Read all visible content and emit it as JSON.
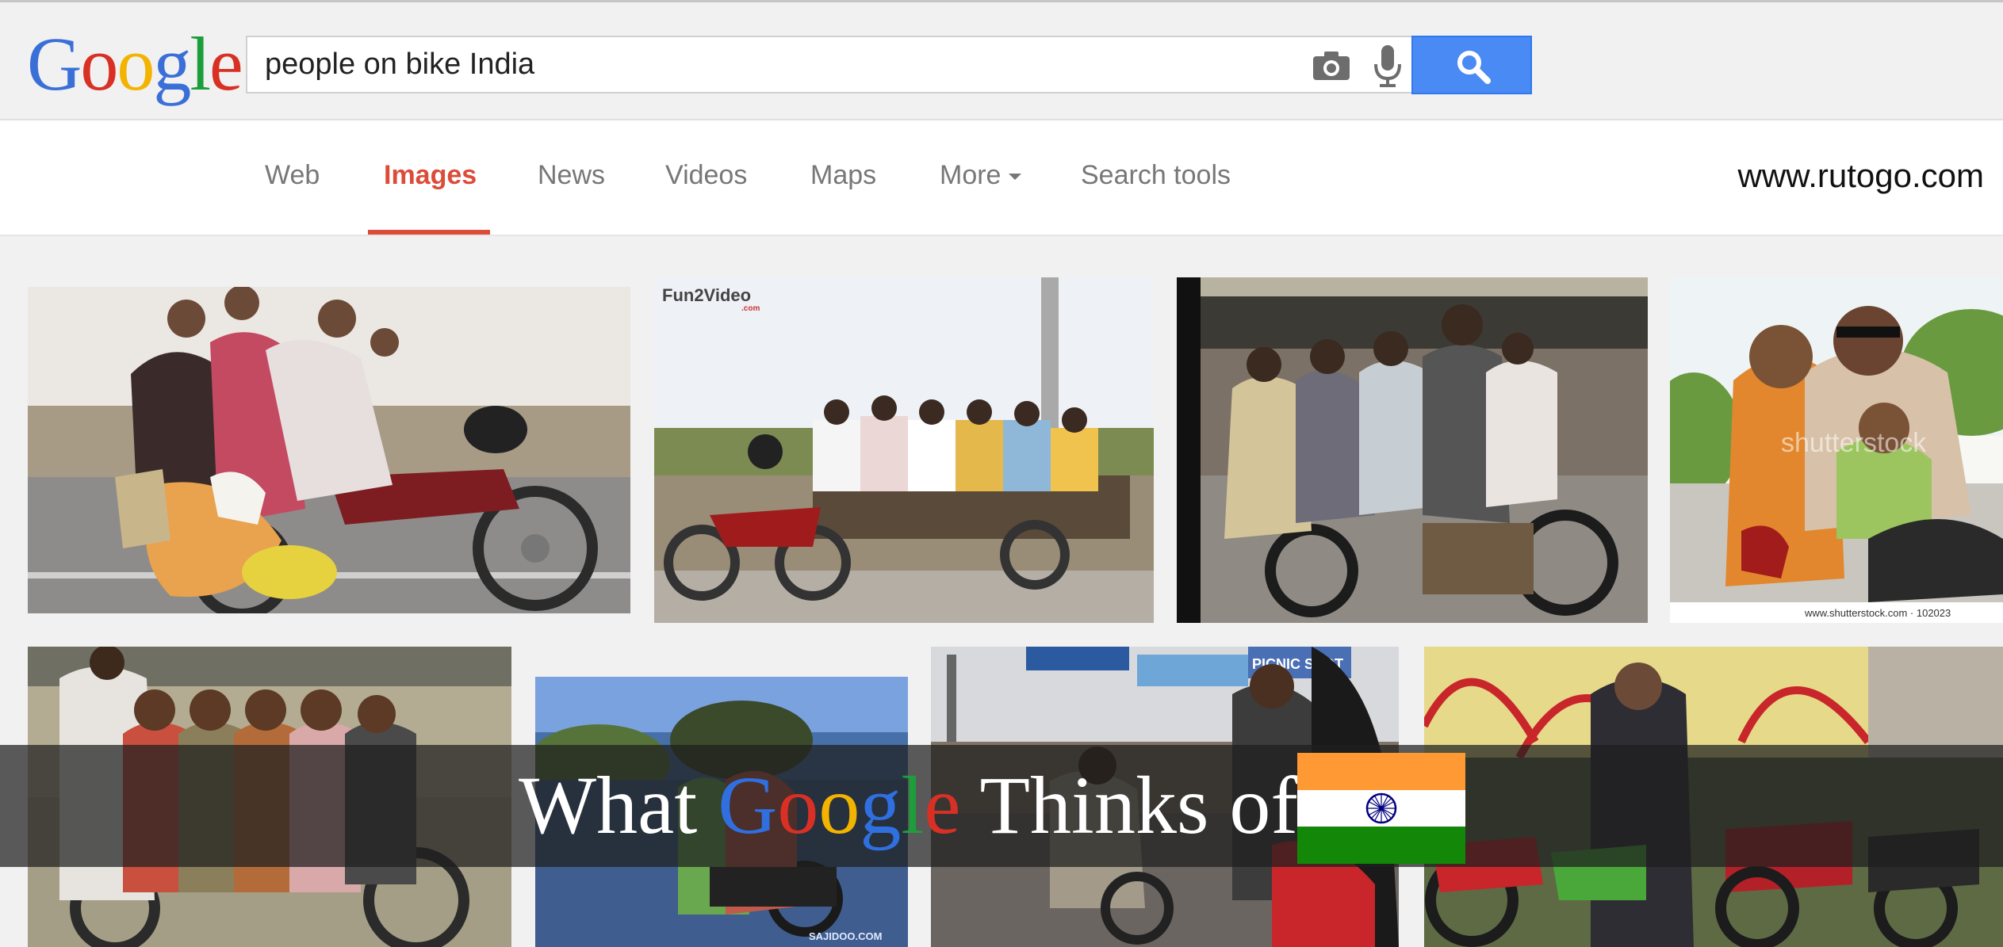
{
  "header": {
    "logo_letters": [
      "G",
      "o",
      "o",
      "g",
      "l",
      "e"
    ],
    "logo_colors": [
      "#3b6fd8",
      "#d93025",
      "#f2b400",
      "#3b6fd8",
      "#1e9e3b",
      "#d93025"
    ],
    "query": "people on bike India",
    "search_button_color": "#4a8af4"
  },
  "nav": {
    "items": [
      "Web",
      "Images",
      "News",
      "Videos",
      "Maps",
      "More",
      "Search tools"
    ],
    "active": "Images",
    "active_color": "#dd4b39",
    "site": "www.rutogo.com"
  },
  "results": {
    "watermarks": {
      "thumb2_logo": "Fun2Video",
      "thumb2_logo_sub": ".com",
      "thumb4_mark": "shutterstock",
      "thumb4_caption": "www.shutterstock.com · 102023",
      "thumb6_caption": "SAJIDOO.COM",
      "thumb7_sign": "PICNIC SPOT"
    }
  },
  "banner": {
    "prefix": "What ",
    "google_letters": [
      "G",
      "o",
      "o",
      "g",
      "l",
      "e"
    ],
    "suffix": " Thinks of",
    "flag_colors": [
      "#ff9933",
      "#ffffff",
      "#138808"
    ],
    "chakra_color": "#000080"
  }
}
